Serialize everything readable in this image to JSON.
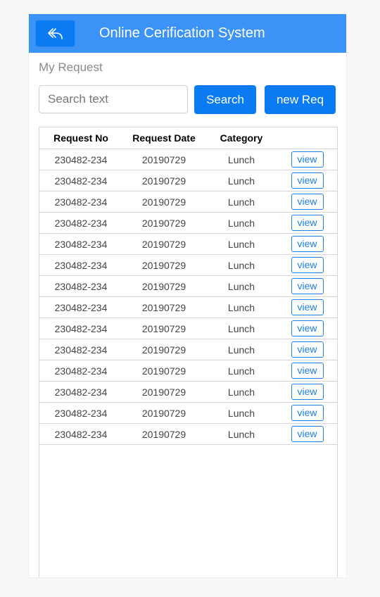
{
  "header": {
    "title": "Online Cerification System",
    "back_icon": "reply-arrow-icon"
  },
  "page": {
    "title": "My Request"
  },
  "search": {
    "placeholder": "Search text",
    "value": "",
    "button_label": "Search"
  },
  "new_request": {
    "button_label": "new Req"
  },
  "colors": {
    "header_bg": "#3b93f8",
    "primary": "#0a7bf3",
    "link": "#1e7fe6"
  },
  "table": {
    "columns": [
      "Request No",
      "Request Date",
      "Category",
      ""
    ],
    "rows": [
      {
        "request_no": "230482-234",
        "date": "20190729",
        "category": "Lunch",
        "action": "view"
      },
      {
        "request_no": "230482-234",
        "date": "20190729",
        "category": "Lunch",
        "action": "view"
      },
      {
        "request_no": "230482-234",
        "date": "20190729",
        "category": "Lunch",
        "action": "view"
      },
      {
        "request_no": "230482-234",
        "date": "20190729",
        "category": "Lunch",
        "action": "view"
      },
      {
        "request_no": "230482-234",
        "date": "20190729",
        "category": "Lunch",
        "action": "view"
      },
      {
        "request_no": "230482-234",
        "date": "20190729",
        "category": "Lunch",
        "action": "view"
      },
      {
        "request_no": "230482-234",
        "date": "20190729",
        "category": "Lunch",
        "action": "view"
      },
      {
        "request_no": "230482-234",
        "date": "20190729",
        "category": "Lunch",
        "action": "view"
      },
      {
        "request_no": "230482-234",
        "date": "20190729",
        "category": "Lunch",
        "action": "view"
      },
      {
        "request_no": "230482-234",
        "date": "20190729",
        "category": "Lunch",
        "action": "view"
      },
      {
        "request_no": "230482-234",
        "date": "20190729",
        "category": "Lunch",
        "action": "view"
      },
      {
        "request_no": "230482-234",
        "date": "20190729",
        "category": "Lunch",
        "action": "view"
      },
      {
        "request_no": "230482-234",
        "date": "20190729",
        "category": "Lunch",
        "action": "view"
      },
      {
        "request_no": "230482-234",
        "date": "20190729",
        "category": "Lunch",
        "action": "view"
      }
    ]
  }
}
